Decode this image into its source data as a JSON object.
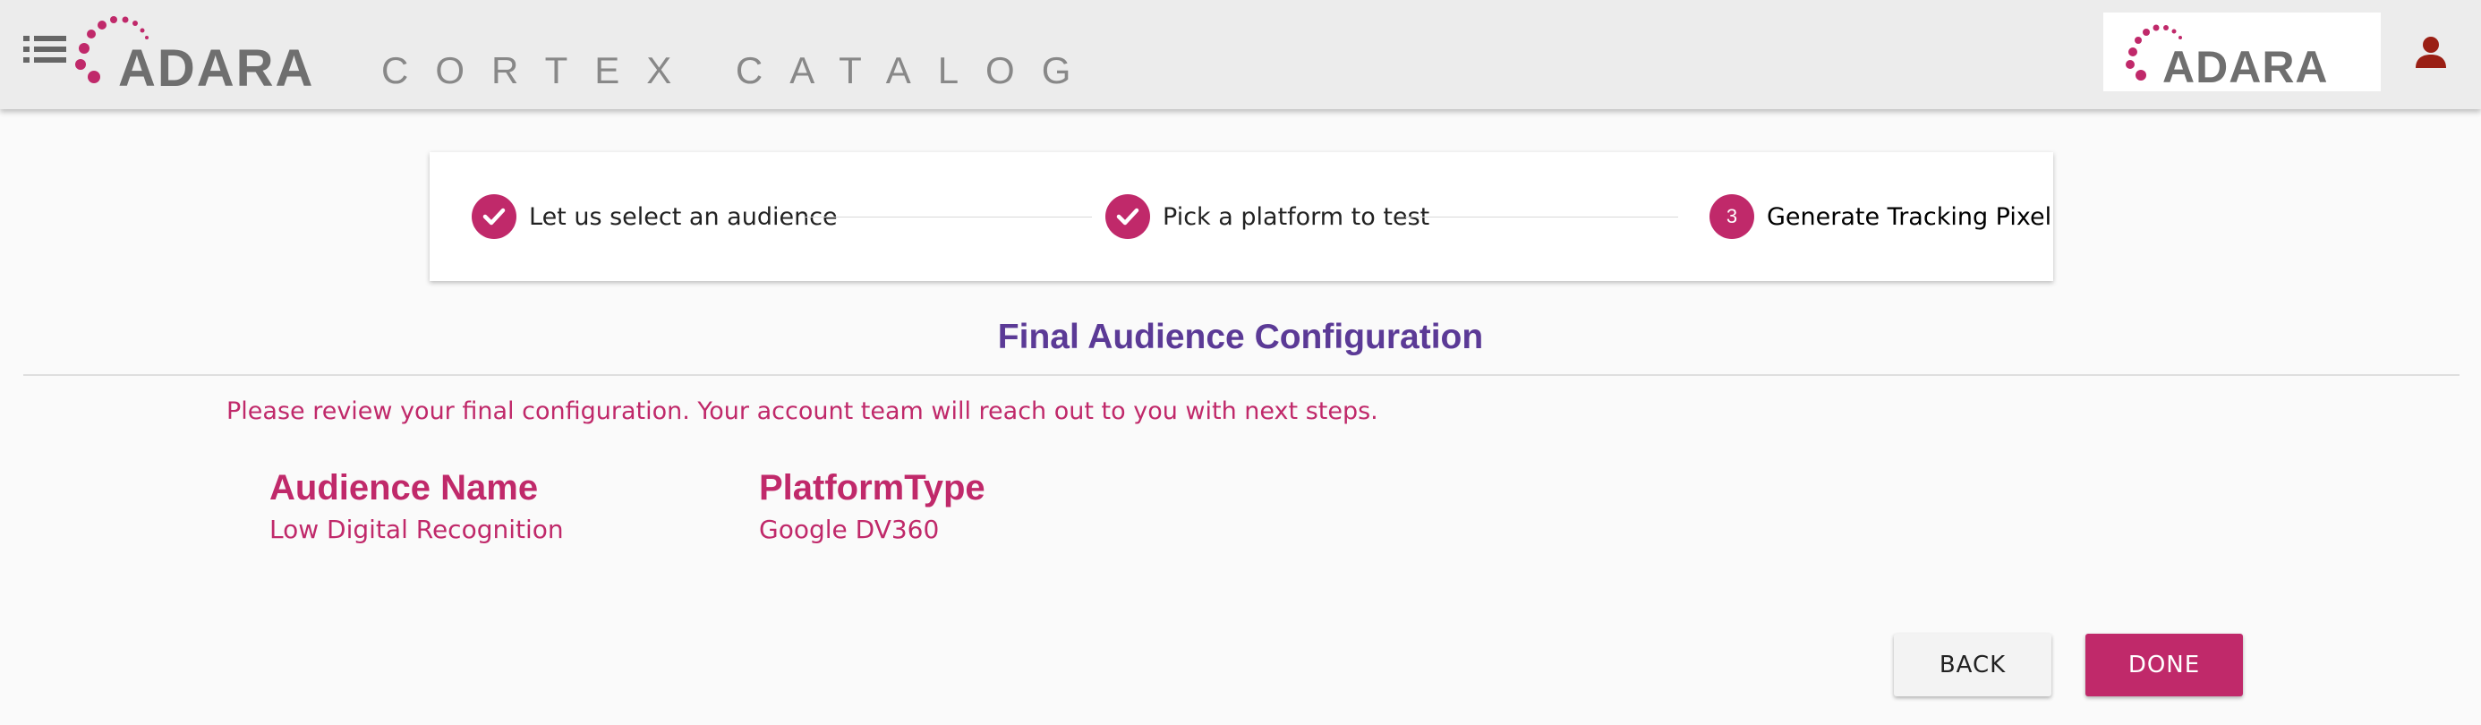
{
  "header": {
    "brand": "ADARA",
    "product_name": "CORTEX CATALOG",
    "brand_right": "ADARA"
  },
  "stepper": {
    "steps": [
      {
        "label": "Let us select an audience",
        "state": "complete"
      },
      {
        "label": "Pick a platform to test",
        "state": "complete"
      },
      {
        "label": "Generate Tracking Pixel",
        "state": "active",
        "number": "3"
      }
    ]
  },
  "main": {
    "title": "Final Audience Configuration",
    "intro": "Please review your final configuration. Your account team will reach out to you with next steps.",
    "fields": [
      {
        "label": "Audience Name",
        "value": "Low Digital Recognition"
      },
      {
        "label": "PlatformType",
        "value": "Google DV360"
      }
    ]
  },
  "actions": {
    "back_label": "BACK",
    "done_label": "DONE"
  },
  "colors": {
    "accent": "#c0296a",
    "title": "#5b3a96",
    "header_bg": "#ececec"
  }
}
